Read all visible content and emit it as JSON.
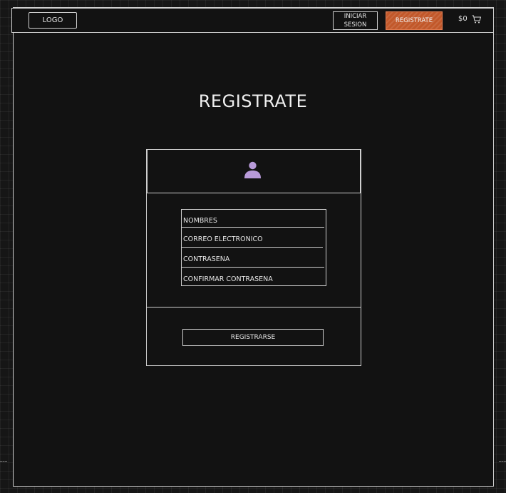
{
  "navbar": {
    "logo_label": "LOGO",
    "login_label": "INICIAR SESION",
    "register_label": "REGISTRATE",
    "cart_amount": "$0",
    "cart_icon": "shopping-cart-icon"
  },
  "page": {
    "title": "REGISTRATE"
  },
  "form": {
    "avatar_icon": "user-avatar-icon",
    "avatar_color": "#b89ad9",
    "fields": [
      {
        "placeholder": "NOMBRES"
      },
      {
        "placeholder": "CORREO ELECTRONICO"
      },
      {
        "placeholder": "CONTRASEÑA"
      },
      {
        "placeholder": "CONFIRMAR CONTRASEÑA"
      }
    ],
    "submit_label": "REGISTRARSE"
  },
  "colors": {
    "background": "#121212",
    "accent": "#c2582a",
    "stroke": "#cfcfcf"
  }
}
